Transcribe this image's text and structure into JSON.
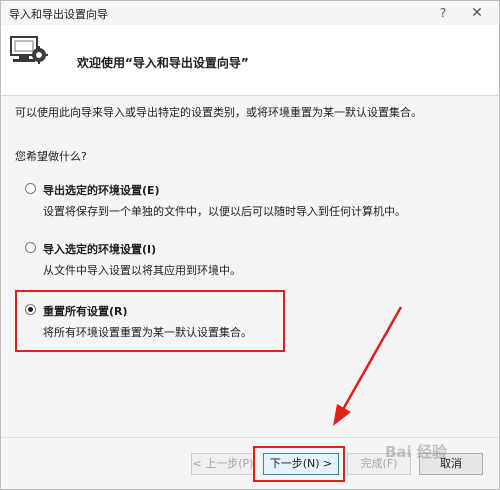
{
  "window": {
    "title": "导入和导出设置向导",
    "help_glyph": "?",
    "close_glyph": "✕"
  },
  "header": {
    "welcome": "欢迎使用“导入和导出设置向导”"
  },
  "main": {
    "description": "可以使用此向导来导入或导出特定的设置类别，或将环境重置为某一默认设置集合。",
    "question": "您希望做什么?",
    "options": [
      {
        "label": "导出选定的环境设置(E)",
        "description": "设置将保存到一个单独的文件中，以便以后可以随时导入到任何计算机中。",
        "selected": false
      },
      {
        "label": "导入选定的环境设置(I)",
        "description": "从文件中导入设置以将其应用到环境中。",
        "selected": false
      },
      {
        "label": "重置所有设置(R)",
        "description": "将所有环境设置重置为某一默认设置集合。",
        "selected": true
      }
    ]
  },
  "footer": {
    "back_label": "< 上一步(P)",
    "next_label": "下一步(N) >",
    "finish_label": "完成(F)",
    "cancel_label": "取消",
    "watermark": "Bai 经验"
  },
  "colors": {
    "highlight": "#e0201b",
    "background": "#f5f5f5",
    "header_bg": "#ffffff"
  }
}
